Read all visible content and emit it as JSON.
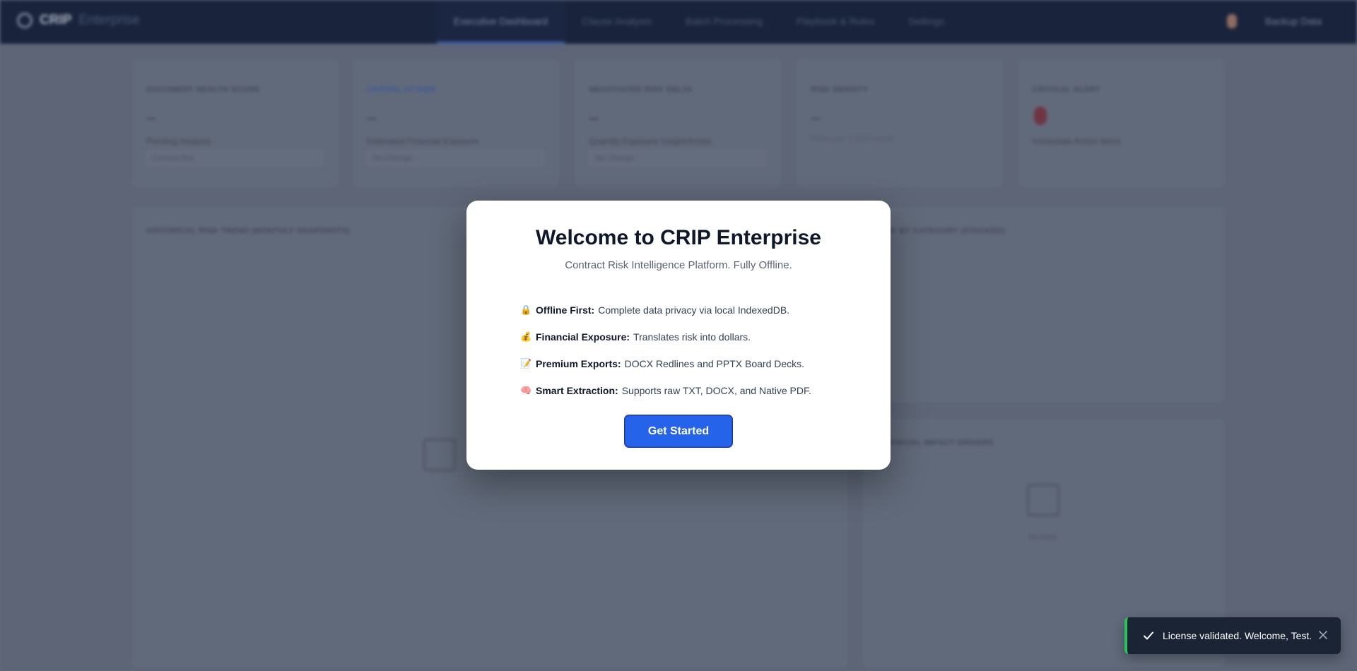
{
  "app": {
    "brand_name": "CRIP",
    "brand_sub": "Enterprise",
    "nav_tabs": [
      {
        "label": "Executive Dashboard",
        "active": true
      },
      {
        "label": "Clause Analysis",
        "active": false
      },
      {
        "label": "Batch Processing",
        "active": false
      },
      {
        "label": "Playbook & Rules",
        "active": false
      },
      {
        "label": "Settings",
        "active": false
      }
    ],
    "user_name": "Backup Data"
  },
  "kpis": [
    {
      "label": "DOCUMENT HEALTH SCORE",
      "value": "—",
      "sub": "Pending Analysis",
      "select": "Current Doc",
      "label_color": "default"
    },
    {
      "label": "CAPITAL AT RISK",
      "value": "—",
      "sub": "Estimated Financial Exposure",
      "select": "No Change",
      "label_color": "blue"
    },
    {
      "label": "NEGOTIATED RISK DELTA",
      "value": "—",
      "sub": "Quantity Exposure Insight/Action",
      "select": "No Change",
      "label_color": "default"
    },
    {
      "label": "RISK DENSITY",
      "value": "—",
      "sub": "Risks per 1,000 words",
      "label_color": "default"
    },
    {
      "label": "CRITICAL ALERT",
      "value": "0",
      "sub": "Immediate Action Items",
      "label_color": "default"
    }
  ],
  "panels": {
    "timeline_title": "HISTORICAL RISK TREND (MONTHLY SNAPSHOTS)",
    "category_title": "RISK BY CATEGORY (STACKED)",
    "impact_title": "FINANCIAL IMPACT DRIVERS",
    "no_data": "No Data"
  },
  "modal": {
    "title": "Welcome to CRIP Enterprise",
    "subtitle": "Contract Risk Intelligence Platform. Fully Offline.",
    "features": [
      {
        "emoji": "🔒",
        "title": "Offline First:",
        "text": "Complete data privacy via local IndexedDB."
      },
      {
        "emoji": "💰",
        "title": "Financial Exposure:",
        "text": "Translates risk into dollars."
      },
      {
        "emoji": "📝",
        "title": "Premium Exports:",
        "text": "DOCX Redlines and PPTX Board Decks."
      },
      {
        "emoji": "🧠",
        "title": "Smart Extraction:",
        "text": "Supports raw TXT, DOCX, and Native PDF."
      }
    ],
    "button_label": "Get Started"
  },
  "toast": {
    "message": "License validated. Welcome, Test.",
    "accent": "#22c55e"
  },
  "colors": {
    "primary": "#2563eb",
    "topbar": "#0d1833",
    "critical": "#dc2626"
  }
}
